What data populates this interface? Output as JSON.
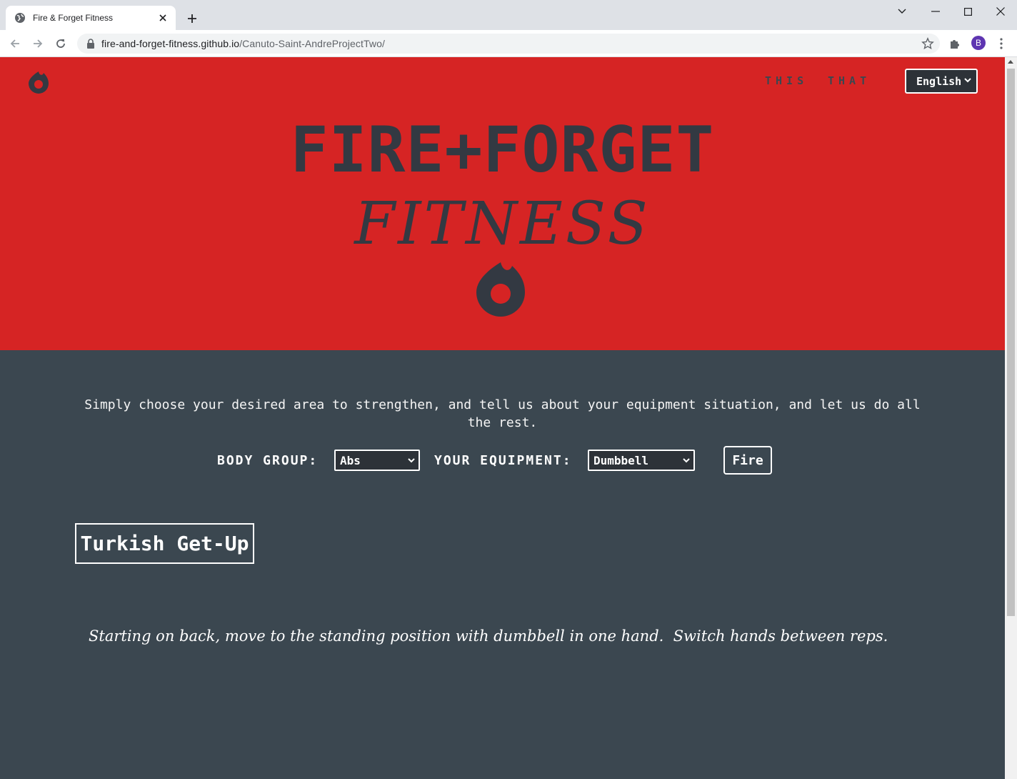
{
  "browser": {
    "tab_title": "Fire & Forget Fitness",
    "url_host": "fire-and-forget-fitness.github.io",
    "url_path": "/Canuto-Saint-AndreProjectTwo/",
    "profile_initial": "B"
  },
  "header": {
    "nav": [
      "THIS",
      "THAT"
    ],
    "language": "English"
  },
  "hero": {
    "title": "FIRE+FORGET",
    "subtitle": "FITNESS"
  },
  "main": {
    "intro": "Simply choose your desired area to strengthen, and tell us about your equipment situation, and let us do all the rest.",
    "body_group_label": "BODY GROUP:",
    "body_group_value": "Abs",
    "equipment_label": "YOUR EQUIPMENT:",
    "equipment_value": "Dumbbell",
    "fire_label": "Fire"
  },
  "exercise": {
    "name": "Turkish Get-Up",
    "description": "Starting on back, move to the standing position with dumbbell in one hand.  Switch hands between reps."
  },
  "colors": {
    "brand_red": "#d62424",
    "dark_slate": "#3b4750",
    "charcoal": "#333942"
  },
  "icons": [
    "globe-icon",
    "close-icon",
    "plus-icon",
    "back-icon",
    "forward-icon",
    "reload-icon",
    "lock-icon",
    "star-icon",
    "puzzle-icon",
    "kebab-icon",
    "flame-logo-icon",
    "chevron-down-icon"
  ]
}
